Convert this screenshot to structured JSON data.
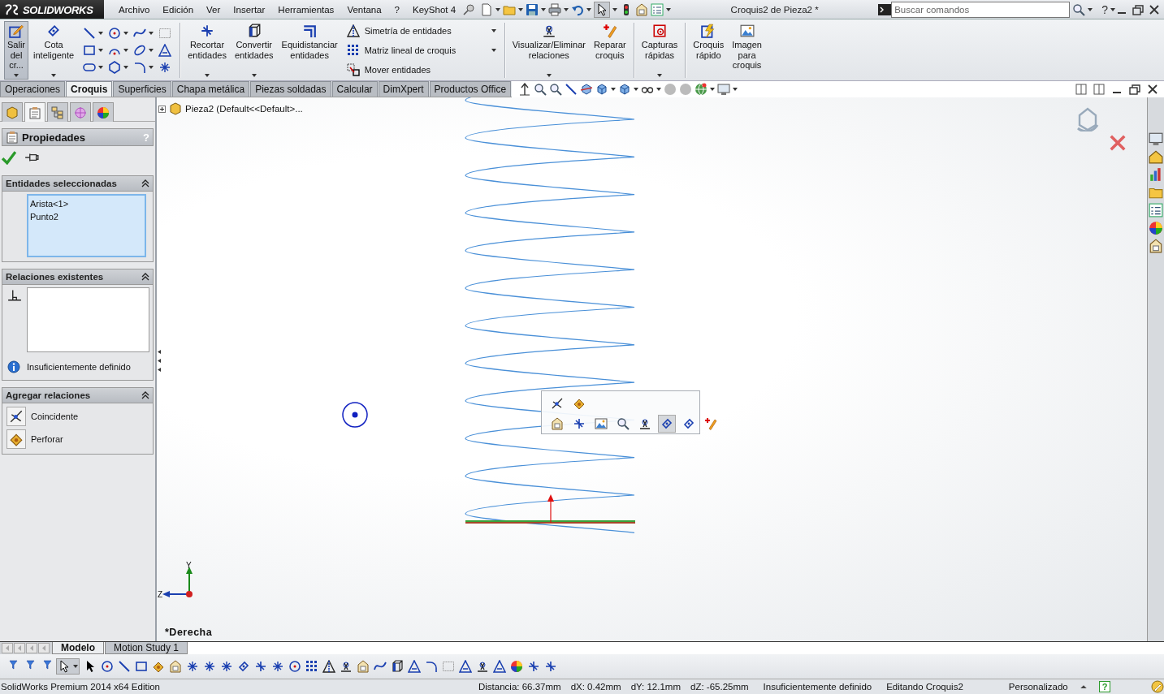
{
  "logo": {
    "text": "SOLIDWORKS"
  },
  "menu": [
    "Archivo",
    "Edición",
    "Ver",
    "Insertar",
    "Herramientas",
    "Ventana",
    "?",
    "KeyShot 4"
  ],
  "window": {
    "title": "Croquis2 de Pieza2 *",
    "help": "?"
  },
  "search": {
    "placeholder": "Buscar comandos"
  },
  "ribbon": [
    {
      "kind": "large",
      "label": "Salir del cr...",
      "selected": true,
      "dropdown": true
    },
    {
      "kind": "large",
      "label": "Cota inteligente",
      "selected": false,
      "dropdown": true
    },
    {
      "kind": "tools"
    },
    {
      "kind": "separator"
    },
    {
      "kind": "large",
      "label": "Recortar entidades",
      "selected": false,
      "dropdown": true
    },
    {
      "kind": "large",
      "label": "Convertir entidades",
      "selected": false,
      "dropdown": true
    },
    {
      "kind": "large",
      "label": "Equidistanciar entidades",
      "selected": false,
      "dropdown": false
    },
    {
      "kind": "list",
      "items": [
        {
          "label": "Simetría de entidades",
          "dropdown": true
        },
        {
          "label": "Matriz lineal de croquis",
          "dropdown": true
        },
        {
          "label": "Mover entidades",
          "dropdown": false
        }
      ]
    },
    {
      "kind": "separator"
    },
    {
      "kind": "large",
      "label": "Visualizar/Eliminar relaciones",
      "selected": false,
      "dropdown": true
    },
    {
      "kind": "large",
      "label": "Reparar croquis",
      "selected": false,
      "dropdown": false
    },
    {
      "kind": "separator"
    },
    {
      "kind": "large",
      "label": "Capturas rápidas",
      "selected": false,
      "dropdown": true
    },
    {
      "kind": "separator"
    },
    {
      "kind": "large",
      "label": "Croquis rápido",
      "selected": false,
      "dropdown": false
    },
    {
      "kind": "large",
      "label": "Imagen para croquis",
      "selected": false,
      "dropdown": false
    }
  ],
  "tabs": [
    {
      "label": "Operaciones",
      "selected": false
    },
    {
      "label": "Croquis",
      "selected": true
    },
    {
      "label": "Superficies",
      "selected": false
    },
    {
      "label": "Chapa metálica",
      "selected": false
    },
    {
      "label": "Piezas soldadas",
      "selected": false
    },
    {
      "label": "Calcular",
      "selected": false
    },
    {
      "label": "DimXpert",
      "selected": false
    },
    {
      "label": "Productos Office",
      "selected": false
    }
  ],
  "panel_tabs": [
    {
      "selected": false
    },
    {
      "selected": true
    },
    {
      "selected": false
    },
    {
      "selected": false
    },
    {
      "selected": false
    }
  ],
  "property_manager": {
    "title": "Propiedades",
    "help": "?",
    "sections": [
      {
        "kind": "selection",
        "title": "Entidades seleccionadas",
        "expanded": true,
        "items": [
          "Arista<1>",
          "Punto2"
        ]
      },
      {
        "kind": "relations",
        "title": "Relaciones existentes",
        "expanded": true,
        "status": "Insuficientemente definido"
      },
      {
        "kind": "add",
        "title": "Agregar relaciones",
        "expanded": true,
        "items": [
          "Coincidente",
          "Perforar"
        ]
      }
    ]
  },
  "viewport": {
    "tree_item": "Pieza2  (Default<<Default>...",
    "view_name": "*Derecha",
    "axis_y": "Y",
    "axis_z": "Z"
  },
  "bottom_tabs": [
    {
      "label": "Modelo",
      "selected": true
    },
    {
      "label": "Motion Study 1",
      "selected": false
    }
  ],
  "status_bar": {
    "edition": "SolidWorks Premium 2014 x64 Edition",
    "distance": "Distancia: 66.37mm",
    "dx": "dX: 0.42mm",
    "dy": "dY: 12.1mm",
    "dz": "dZ: -65.25mm",
    "state": "Insuficientemente definido",
    "editing": "Editando Croquis2",
    "units": "Personalizado",
    "help": "?"
  }
}
